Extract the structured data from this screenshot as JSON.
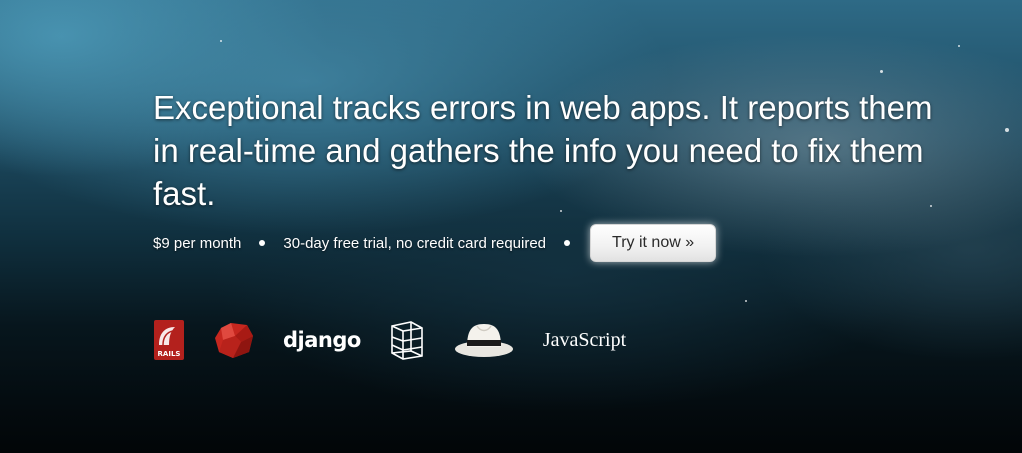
{
  "hero": {
    "headline": "Exceptional tracks errors in web apps. It reports them in real-time and gathers the info you need to fix them fast.",
    "price": "$9 per month",
    "trial": "30-day free trial, no credit card required",
    "cta_label": "Try it now »"
  },
  "logos": {
    "rails": {
      "icon": "rails-icon",
      "text": "RAILS"
    },
    "ruby": {
      "icon": "ruby-gem-icon"
    },
    "django": {
      "text": "django"
    },
    "rack": {
      "icon": "wireframe-box-icon"
    },
    "hat": {
      "icon": "fedora-hat-icon"
    },
    "javascript": {
      "text": "JavaScript"
    }
  },
  "colors": {
    "text": "#ffffff",
    "button_text": "#2a2a2a",
    "rails_red": "#b3211d",
    "ruby_red": "#c6271f"
  }
}
